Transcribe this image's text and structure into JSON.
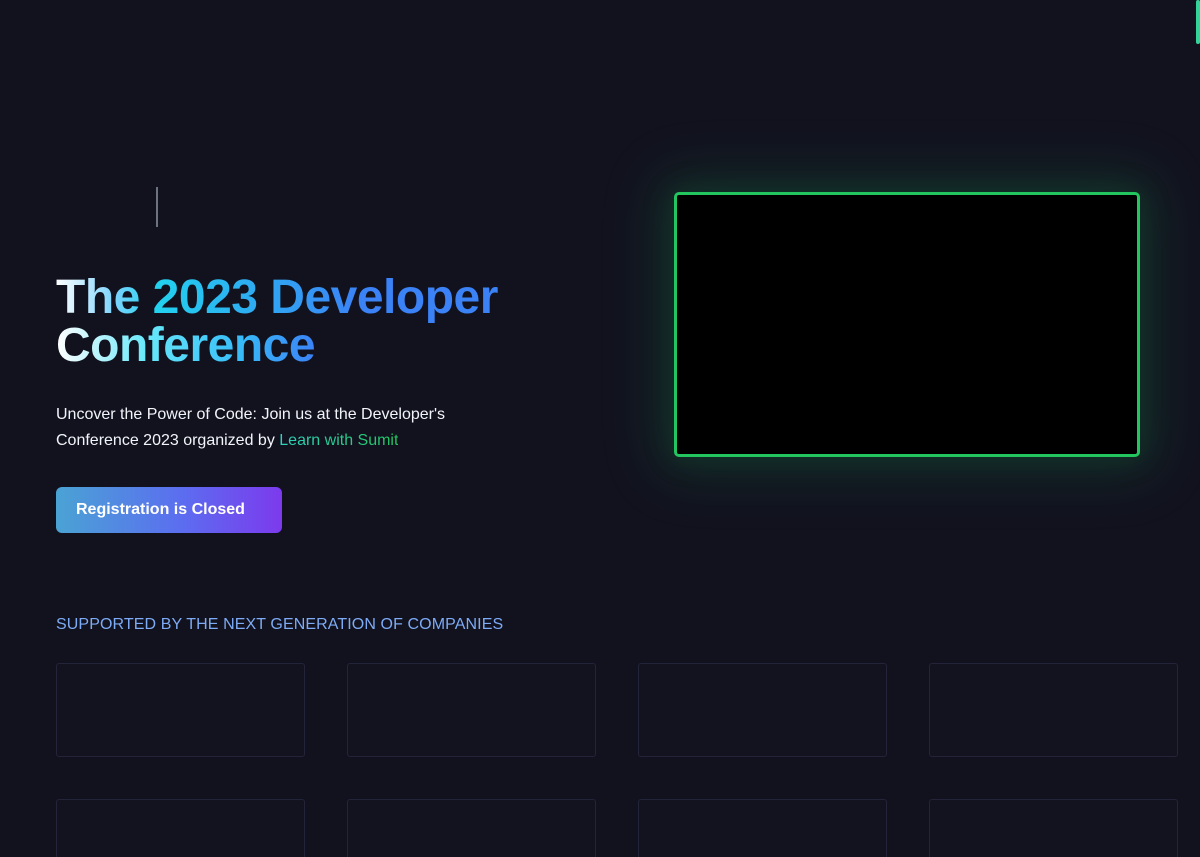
{
  "hero": {
    "title_part1": "The ",
    "title_part2": "2023 Developer",
    "title_part3": "Conference",
    "description_text": "Uncover the Power of Code: Join us at the Developer's Conference 2023 organized by ",
    "description_link": "Learn with Sumit",
    "register_button_label": "Registration is Closed"
  },
  "sponsors": {
    "heading": "SUPPORTED BY THE NEXT GENERATION OF COMPANIES"
  },
  "colors": {
    "background": "#12121f",
    "accent_green": "#22c55e",
    "accent_blue": "#3b82f6",
    "accent_purple": "#7c3aed",
    "heading_blue": "#7dabf5"
  }
}
